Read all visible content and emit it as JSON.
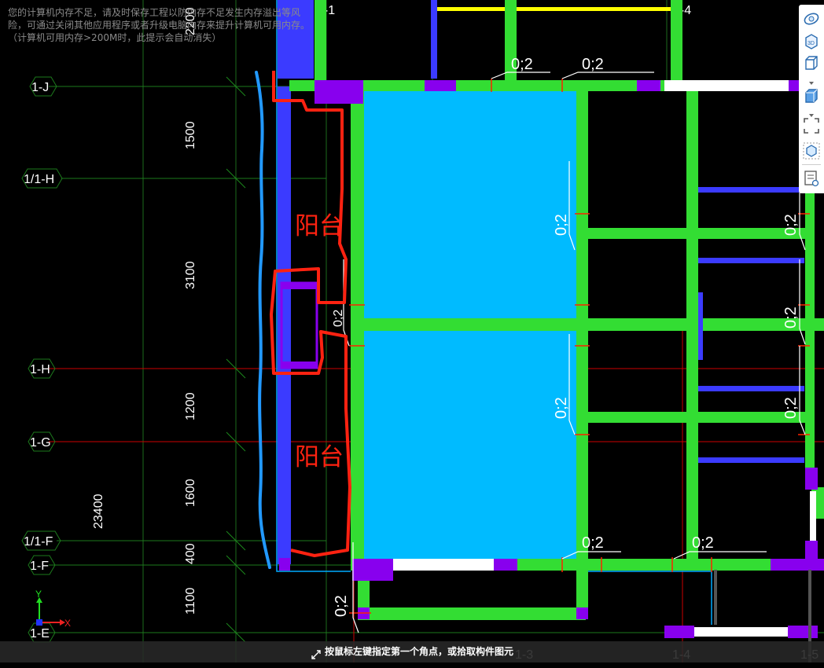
{
  "warning_text": "您的计算机内存不足，请及时保存工程以防内存不足发生内存溢出等风险，可通过关闭其他应用程序或者升级电脑内存来提升计算机可用内存。（计算机可用内存>200M时，此提示会自动消失）",
  "grid": {
    "axis_labels": {
      "j": "1-J",
      "h1": "1/1-H",
      "h": "1-H",
      "g": "1-G",
      "f1": "1/1-F",
      "f": "1-F",
      "e": "1-E",
      "top1": "1-1",
      "top4": "1-4",
      "bot3": "1-3",
      "bot4": "1-4",
      "bot5": "1-5"
    },
    "dimensions": {
      "d2200": "2200",
      "d1500": "1500",
      "d3100": "3100",
      "d1200": "1200",
      "d1600": "1600",
      "d400": "400",
      "d1100": "1100",
      "total": "23400"
    }
  },
  "annotations": {
    "balcony_1": "阳台",
    "balcony_2": "阳台",
    "beam_label": "0;2"
  },
  "coordinate_axes": {
    "y": "Y",
    "x": "X"
  },
  "toolbar": {
    "items": [
      "orbit-icon",
      "view-3d-icon",
      "cube-view-icon",
      "cube-solid-icon",
      "fit-view-icon",
      "layer-box-icon",
      "properties-icon"
    ]
  },
  "status": {
    "prompt": "按鼠标左键指定第一个角点，或拾取构件图元"
  },
  "colors": {
    "background": "#000000",
    "wall_green": "#33dd33",
    "slab_cyan": "#00bbff",
    "column_purple": "#8800ee",
    "beam_blue": "#3333ff",
    "mark_red": "#ff2211",
    "boundary_blue": "#2299ff",
    "axis_line_green": "#1d7a1d",
    "axis_line_red": "#cc0000",
    "dim_yellow": "#ffff00"
  }
}
